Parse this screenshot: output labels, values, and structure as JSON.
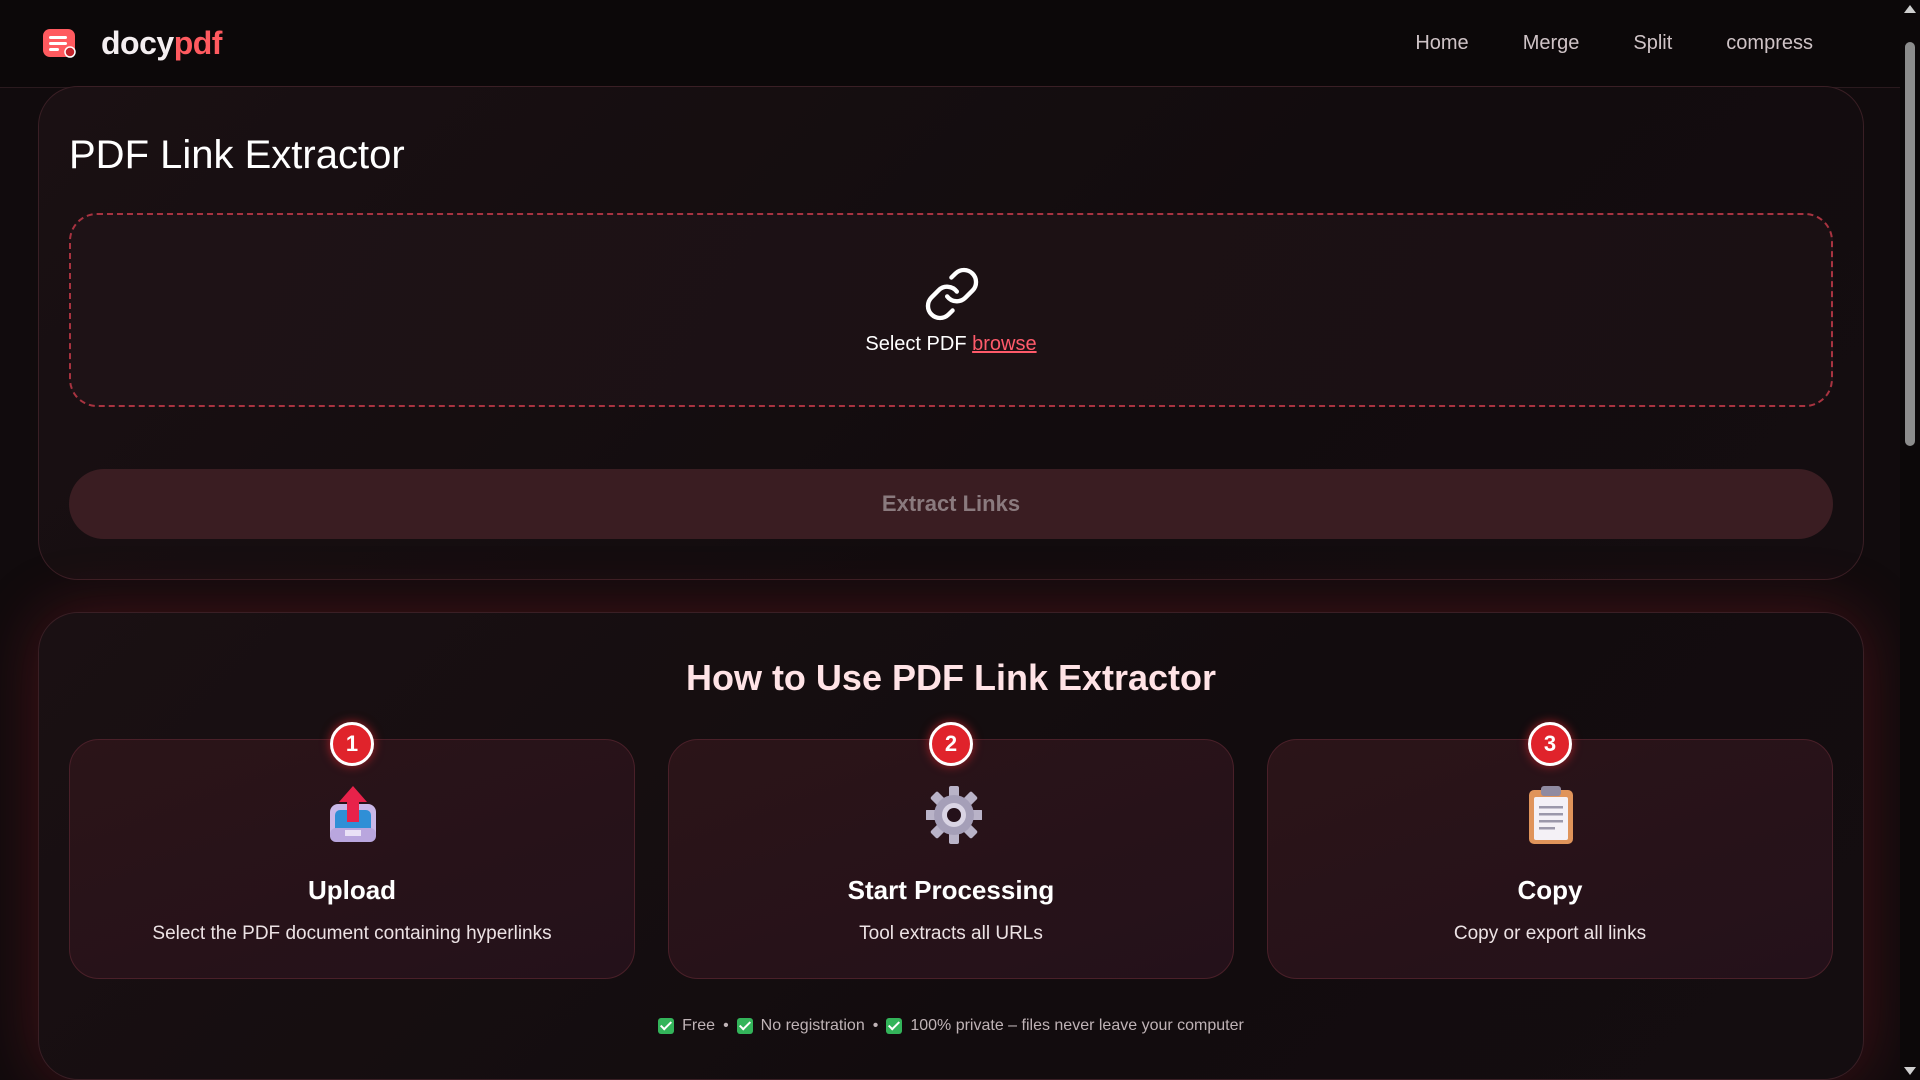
{
  "header": {
    "brand_part1": "docy",
    "brand_part2": "pdf",
    "nav": [
      {
        "label": "Home"
      },
      {
        "label": "Merge"
      },
      {
        "label": "Split"
      },
      {
        "label": "compress"
      }
    ]
  },
  "tool": {
    "title": "PDF Link Extractor",
    "dropzone_text": "Select PDF",
    "browse_label": "browse",
    "extract_label": "Extract Links"
  },
  "how_to": {
    "title": "How to Use PDF Link Extractor",
    "steps": [
      {
        "number": "1",
        "title": "Upload",
        "desc": "Select the PDF document containing hyperlinks",
        "icon": "upload-inbox-icon"
      },
      {
        "number": "2",
        "title": "Start Processing",
        "desc": "Tool extracts all URLs",
        "icon": "gear-icon"
      },
      {
        "number": "3",
        "title": "Copy",
        "desc": "Copy or export all links",
        "icon": "clipboard-icon"
      }
    ],
    "features": [
      {
        "label": "Free"
      },
      {
        "label": "No registration"
      },
      {
        "label": "100% private – files never leave your computer"
      }
    ]
  },
  "colors": {
    "accent": "#ff5a5f",
    "badge": "#e0232b",
    "check": "#33b45a"
  }
}
